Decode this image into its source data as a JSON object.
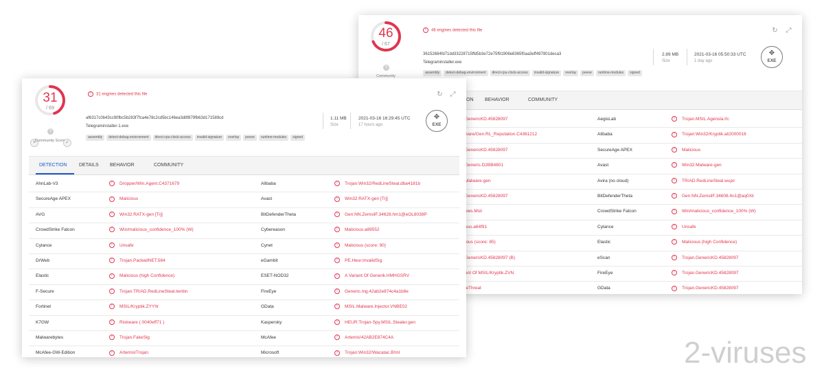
{
  "back_panel": {
    "score": "46",
    "score_total": "/ 67",
    "community_label": "Community",
    "alert_text": "46 engines detected this file",
    "hash": "36152684fd71dd33228715ffd5b3e72e75f91906e8365f0aa3eff497801deca3",
    "filename": "Telegraminstaller.exe",
    "size": "2.89 MB",
    "size_label": "Size",
    "date": "2021-03-16 05:50:33 UTC",
    "date_label": "1 day ago",
    "file_type": "EXE",
    "tags": [
      "assembly",
      "detect-debug-environment",
      "direct-cpu-clock-access",
      "invalid-signature",
      "overlay",
      "peexe",
      "runtime-modules",
      "signed"
    ],
    "tabs": [
      "ON",
      "BEHAVIOR",
      "COMMUNITY"
    ],
    "rows": [
      {
        "left_result": "GenericKD.45828097",
        "right_engine": "AegisLab",
        "right_result": "Trojan.MSIL.Agensla.l!c"
      },
      {
        "left_result": "ware/Gen.RL_Reputation.C4361212",
        "right_engine": "Alibaba",
        "right_result": "Trojan:Win32/Kryptik.ali2000016"
      },
      {
        "left_result": "GenericKD.45828097",
        "right_engine": "SecureAge APEX",
        "right_result": "Malicious"
      },
      {
        "left_result": "Generic.D2BB4801",
        "right_engine": "Avast",
        "right_result": "Win32:Malware-gen"
      },
      {
        "left_result": "Malware-gen",
        "right_engine": "Avira (no cloud)",
        "right_result": "TR/AD.RedLineSteal.wujxr"
      },
      {
        "left_result": "GenericKD.45828097",
        "right_engine": "BitDefenderTheta",
        "right_result": "Gen:NN.ZemsilF.34608.4o1@aq0Xli"
      },
      {
        "left_result": "pws.Msil",
        "right_engine": "CrowdStrike Falcon",
        "right_result": "Win/malicious_confidence_100% (W)"
      },
      {
        "left_result": "ous.a64f91",
        "right_engine": "Cylance",
        "right_result": "Unsafe"
      },
      {
        "left_result": "ious (score: 85)",
        "right_engine": "Elastic",
        "right_result": "Malicious (high Confidence)"
      },
      {
        "left_result": "GenericKD.45828097 (B)",
        "right_engine": "eScan",
        "right_result": "Trojan.GenericKD.45828097"
      },
      {
        "left_result": "ant Of MSIL/Kryptik.ZVN",
        "right_engine": "FireEye",
        "right_result": "Trojan.GenericKD.45828097"
      },
      {
        "left_result": "leThreat",
        "right_engine": "GData",
        "right_result": "Trojan.GenericKD.45828097"
      }
    ]
  },
  "front_panel": {
    "score": "31",
    "score_total": "/ 69",
    "community_label": "Community Score",
    "alert_text": "31 engines detected this file",
    "hash": "af6317c0b43cc90fbc5b283f7fca4e78c2cd5bc146ea3d8f879fb63d171589cd",
    "filename": "Telegraminstaller-1.exe",
    "size": "1.11 MB",
    "size_label": "Size",
    "date": "2021-03-16 16:29:45 UTC",
    "date_label": "17 hours ago",
    "file_type": "EXE",
    "tags": [
      "assembly",
      "detect-debug-environment",
      "direct-cpu-clock-access",
      "invalid-signature",
      "overlay",
      "peexe",
      "runtime-modules",
      "signed"
    ],
    "tabs": [
      "DETECTION",
      "DETAILS",
      "BEHAVIOR",
      "COMMUNITY"
    ],
    "rows": [
      {
        "left_engine": "AhnLab-V3",
        "left_result": "Dropper/Win.Agent.C4371679",
        "right_engine": "Alibaba",
        "right_result": "Trojan:Win32/RedLineSteal.dba4181b"
      },
      {
        "left_engine": "SecureAge APEX",
        "left_result": "Malicious",
        "right_engine": "Avast",
        "right_result": "Win32:RATX-gen [Trj]"
      },
      {
        "left_engine": "AVG",
        "left_result": "Win32:RATX-gen [Trj]",
        "right_engine": "BitDefenderTheta",
        "right_result": "Gen:NN.ZemsilF.34628.hm1@eOL8038P"
      },
      {
        "left_engine": "CrowdStrike Falcon",
        "left_result": "Win/malicious_confidence_100% (W)",
        "right_engine": "Cybereason",
        "right_result": "Malicious.a89552"
      },
      {
        "left_engine": "Cylance",
        "left_result": "Unsafe",
        "right_engine": "Cynet",
        "right_result": "Malicious (score: 90)"
      },
      {
        "left_engine": "DrWeb",
        "left_result": "Trojan.PackedNET.584",
        "right_engine": "eGambit",
        "right_result": "PE.Heur.InvalidSig"
      },
      {
        "left_engine": "Elastic",
        "left_result": "Malicious (high Confidence)",
        "right_engine": "ESET-NOD32",
        "right_result": "A Variant Of Generik.HMHGSRV"
      },
      {
        "left_engine": "F-Secure",
        "left_result": "Trojan.TR/AD.RedLineSteal.twnbn",
        "right_engine": "FireEye",
        "right_result": "Generic.mg.42ab2e874c4a1b8e"
      },
      {
        "left_engine": "Fortinet",
        "left_result": "MSIL/Kryptik.ZYY!tr",
        "right_engine": "GData",
        "right_result": "MSIL.Malware.Injector.VNBE02"
      },
      {
        "left_engine": "K7GW",
        "left_result": "Riskware ( 0040eff71 )",
        "right_engine": "Kaspersky",
        "right_result": "HEUR:Trojan-Spy.MSIL.Stealer.gen"
      },
      {
        "left_engine": "Malwarebytes",
        "left_result": "Trojan.FakeSig",
        "right_engine": "McAfee",
        "right_result": "Artemis!42AB2E874C4A"
      },
      {
        "left_engine": "McAfee-GW-Edition",
        "left_result": "ArtemisITrojan",
        "right_engine": "Microsoft",
        "right_result": "Trojan:Win32/Wacatac.B!ml"
      }
    ]
  },
  "watermark": "2-viruses",
  "colors": {
    "accent_red": "#e0354f",
    "tab_blue": "#1e58c8",
    "gauge_track": "#e8e8e8"
  },
  "icons": {
    "alert": "alert-circle-icon",
    "refresh": "refresh-icon",
    "expand": "expand-icon",
    "file_type": "exe-file-icon",
    "question": "question-icon"
  }
}
